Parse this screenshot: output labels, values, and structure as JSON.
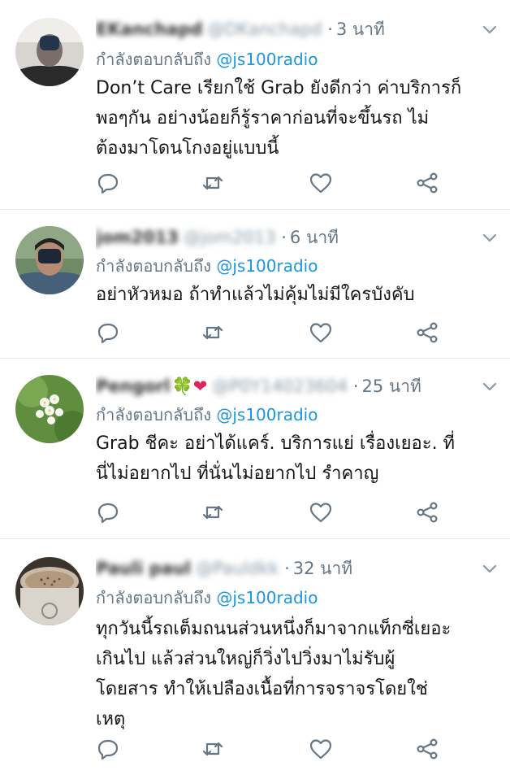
{
  "tweets": [
    {
      "name": "EKanchapd",
      "handle": "@DKanchapd",
      "time": "3 นาที",
      "reply_prefix": "กำลังตอบกลับถึง",
      "mention": "@js100radio",
      "lines": [
        "Don’t Care เรียกใช้ Grab ยังดีกว่า ค่าบริการก็",
        "พอๆกัน อย่างน้อยก็รู้ราคาก่อนที่จะขึ้นรถ ไม่",
        "ต้องมาโดนโกงอยู่แบบนี้"
      ]
    },
    {
      "name": "jom2013",
      "handle": "@jom2013",
      "time": "6 นาที",
      "reply_prefix": "กำลังตอบกลับถึง",
      "mention": "@js100radio",
      "lines": [
        "อย่าหัวหมอ ถ้าทำแล้วไม่คุ้มไม่มีใครบังคับ"
      ]
    },
    {
      "name": "Pengorl",
      "emoji": "🍀❤",
      "handle": "@P0Y14023604",
      "time": "25 นาที",
      "reply_prefix": "กำลังตอบกลับถึง",
      "mention": "@js100radio",
      "lines": [
        "Grab ชีคะ อย่าได้แคร์.  บริการแย่ เรื่องเยอะ. ที่",
        "นี่ไม่อยากไป ที่นั่นไม่อยากไป รำคาญ"
      ]
    },
    {
      "name": "Pauli paul",
      "handle": "@Pauldkk",
      "time": "32 นาที",
      "reply_prefix": "กำลังตอบกลับถึง",
      "mention": "@js100radio",
      "lines": [
        "ทุกวันนี้รถเต็มถนนส่วนหนึ่งก็มาจากแท็กซี่เยอะ",
        "เกินไป แล้วส่วนใหญ่ก็วิ่งไปวิ่งมาไม่รับผู้",
        "โดยสาร ทำให้เปลืองเนื้อที่การจราจรโดยใช่",
        "เหตุ"
      ]
    }
  ],
  "icons": {
    "avatar": "user-avatar",
    "chevron": "chevron-down-icon",
    "reply": "reply-icon",
    "retweet": "retweet-icon",
    "like": "like-heart-icon",
    "share": "share-icon"
  },
  "colors": {
    "mention": "#1b95e0",
    "meta": "#657786",
    "divider": "#e1e8ed"
  }
}
